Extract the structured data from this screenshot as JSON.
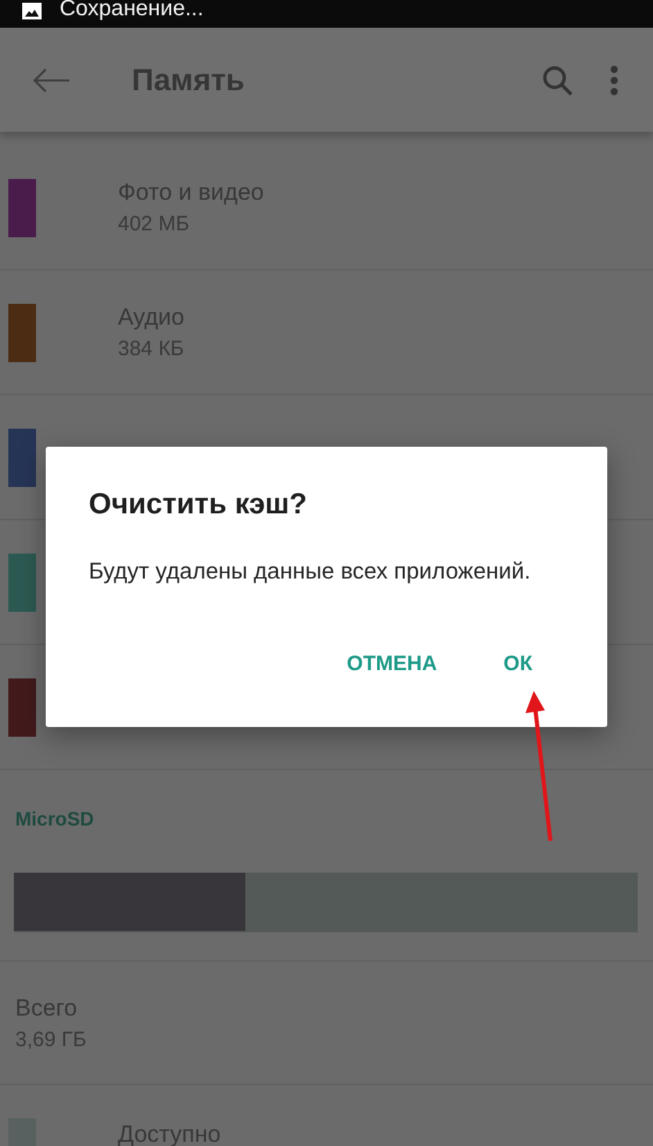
{
  "status_bar": {
    "notification": "Сохранение..."
  },
  "app_bar": {
    "title": "Память"
  },
  "categories": [
    {
      "name": "Фото и видео",
      "size": "402 МБ",
      "color": "#4a1c4c"
    },
    {
      "name": "Аудио",
      "size": "384 КБ",
      "color": "#4c2c12"
    },
    {
      "color": "#263456"
    },
    {
      "color": "#2c5a52"
    },
    {
      "color": "#421a1c"
    }
  ],
  "microsd": {
    "header": "MicroSD",
    "level": 0.37,
    "total_label": "Всего",
    "total": "3,69 ГБ",
    "legend": [
      {
        "label": "Доступно",
        "color": "#596060"
      }
    ]
  },
  "dialog": {
    "title": "Очистить кэш?",
    "message": "Будут удалены данные всех приложений.",
    "buttons": [
      "ОТМЕНА",
      "ОК"
    ]
  }
}
